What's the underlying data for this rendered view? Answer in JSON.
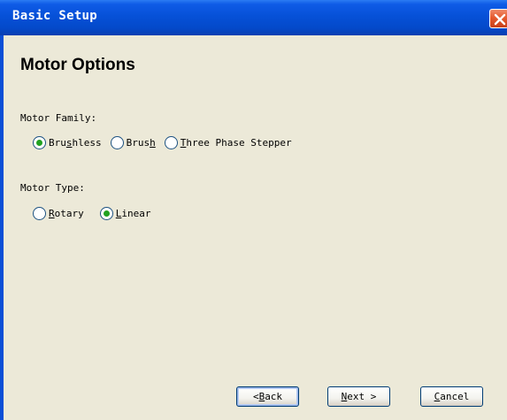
{
  "window": {
    "title": "Basic Setup",
    "close_icon": "close-icon"
  },
  "page": {
    "heading": "Motor Options"
  },
  "motor_family": {
    "label": "Motor Family:",
    "options": [
      {
        "pre": "Bru",
        "accel": "s",
        "post": "hless",
        "checked": true
      },
      {
        "pre": "Brus",
        "accel": "h",
        "post": "",
        "checked": false
      },
      {
        "pre": "",
        "accel": "T",
        "post": "hree Phase Stepper",
        "checked": false
      }
    ]
  },
  "motor_type": {
    "label": "Motor Type:",
    "options": [
      {
        "pre": "",
        "accel": "R",
        "post": "otary",
        "checked": false
      },
      {
        "pre": "",
        "accel": "L",
        "post": "inear",
        "checked": true
      }
    ]
  },
  "buttons": {
    "back": {
      "pre": "< ",
      "accel": "B",
      "post": "ack"
    },
    "next": {
      "pre": "",
      "accel": "N",
      "post": "ext >"
    },
    "cancel": {
      "pre": "",
      "accel": "C",
      "post": "ancel"
    }
  },
  "colors": {
    "titlebar": "#0651d8",
    "dialog_bg": "#ece9d8",
    "radio_dot": "#21a121"
  }
}
